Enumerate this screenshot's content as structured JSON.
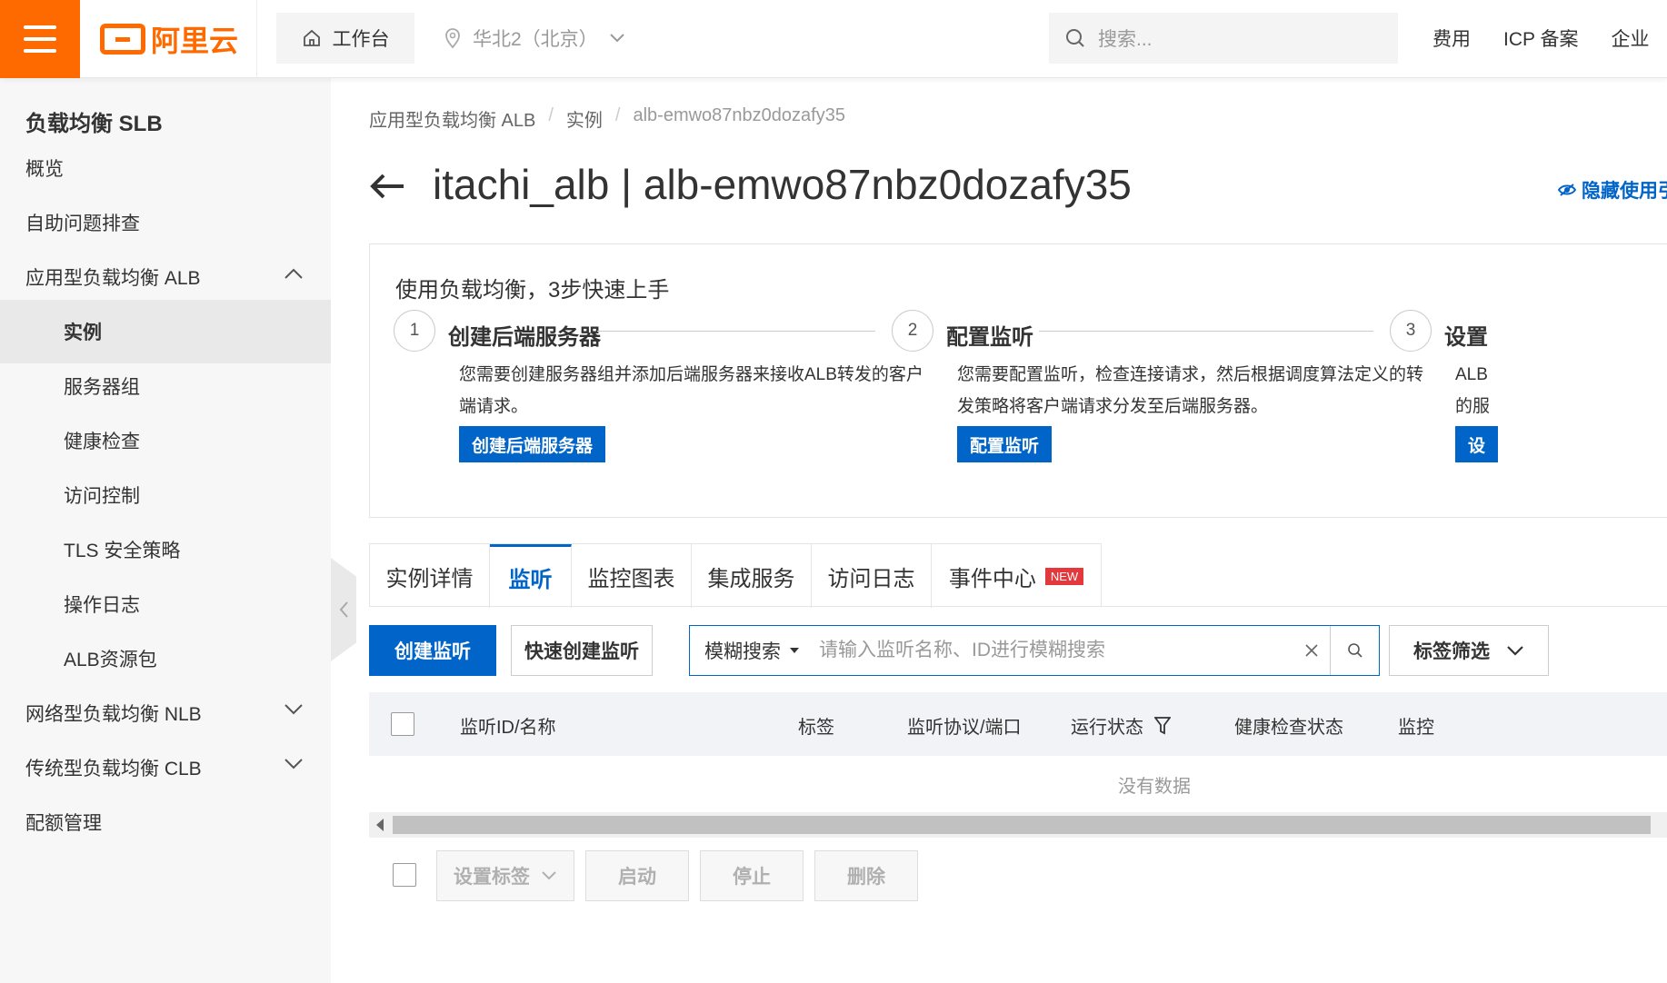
{
  "topbar": {
    "logo_text": "阿里云",
    "workbench": "工作台",
    "region": "华北2（北京）",
    "search_placeholder": "搜索...",
    "links": [
      "费用",
      "ICP 备案",
      "企业"
    ]
  },
  "sidebar": {
    "title": "负载均衡 SLB",
    "items": [
      {
        "label": "概览"
      },
      {
        "label": "自助问题排查"
      },
      {
        "label": "应用型负载均衡 ALB"
      },
      {
        "label": "实例"
      },
      {
        "label": "服务器组"
      },
      {
        "label": "健康检查"
      },
      {
        "label": "访问控制"
      },
      {
        "label": "TLS 安全策略"
      },
      {
        "label": "操作日志"
      },
      {
        "label": "ALB资源包"
      },
      {
        "label": "网络型负载均衡 NLB"
      },
      {
        "label": "传统型负载均衡 CLB"
      },
      {
        "label": "配额管理"
      }
    ]
  },
  "breadcrumb": [
    "应用型负载均衡 ALB",
    "实例",
    "alb-emwo87nbz0dozafy35"
  ],
  "breadcrumb_sep": "/",
  "page_title": "itachi_alb | alb-emwo87nbz0dozafy35",
  "hide_guide": "隐藏使用引",
  "guide": {
    "title": "使用负载均衡，3步快速上手",
    "steps": [
      {
        "num": "1",
        "title": "创建后端服务器",
        "desc1": "您需要创建服务器组并添加后端服务器来接收ALB转发的客户",
        "desc2": "端请求。",
        "button": "创建后端服务器"
      },
      {
        "num": "2",
        "title": "配置监听",
        "desc1": "您需要配置监听，检查连接请求，然后根据调度算法定义的转",
        "desc2": "发策略将客户端请求分发至后端服务器。",
        "button": "配置监听"
      },
      {
        "num": "3",
        "title": "设置",
        "desc1": "ALB",
        "desc2": "的服",
        "button": "设"
      }
    ]
  },
  "tabs": [
    {
      "label": "实例详情"
    },
    {
      "label": "监听"
    },
    {
      "label": "监控图表"
    },
    {
      "label": "集成服务"
    },
    {
      "label": "访问日志"
    },
    {
      "label": "事件中心"
    }
  ],
  "new_badge": "NEW",
  "toolbar": {
    "create": "创建监听",
    "quick_create": "快速创建监听",
    "search_mode": "模糊搜索",
    "search_placeholder": "请输入监听名称、ID进行模糊搜索",
    "tag_filter": "标签筛选"
  },
  "table": {
    "columns": [
      "监听ID/名称",
      "标签",
      "监听协议/端口",
      "运行状态",
      "健康检查状态",
      "监控"
    ],
    "empty": "没有数据"
  },
  "bottom": {
    "set_tag": "设置标签",
    "start": "启动",
    "stop": "停止",
    "delete": "删除"
  },
  "colors": {
    "brand": "#ff6a00",
    "primary": "#0064c8",
    "badge": "#e4393c"
  }
}
